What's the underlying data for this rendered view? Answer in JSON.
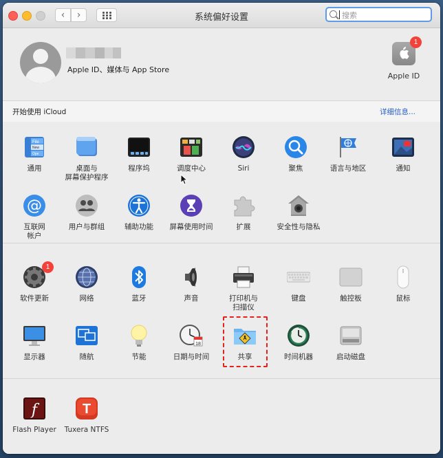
{
  "window": {
    "title": "系统偏好设置",
    "search_placeholder": "搜索"
  },
  "account": {
    "subtitle": "Apple ID、媒体与 App Store",
    "apple_id_label": "Apple ID",
    "apple_id_badge": "1"
  },
  "icloud": {
    "text": "开始使用 iCloud",
    "link": "详细信息..."
  },
  "section1": {
    "items": [
      {
        "label": "通用"
      },
      {
        "label": "桌面与\n屏幕保护程序"
      },
      {
        "label": "程序坞"
      },
      {
        "label": "调度中心"
      },
      {
        "label": "Siri"
      },
      {
        "label": "聚焦"
      },
      {
        "label": "语言与地区"
      },
      {
        "label": "通知"
      },
      {
        "label": "互联网\n帐户"
      },
      {
        "label": "用户与群组"
      },
      {
        "label": "辅助功能"
      },
      {
        "label": "屏幕使用时间"
      },
      {
        "label": "扩展"
      },
      {
        "label": "安全性与隐私"
      }
    ]
  },
  "section2": {
    "items": [
      {
        "label": "软件更新",
        "badge": "1"
      },
      {
        "label": "网络"
      },
      {
        "label": "蓝牙"
      },
      {
        "label": "声音"
      },
      {
        "label": "打印机与\n扫描仪"
      },
      {
        "label": "键盘"
      },
      {
        "label": "触控板"
      },
      {
        "label": "鼠标"
      },
      {
        "label": "显示器"
      },
      {
        "label": "随航"
      },
      {
        "label": "节能"
      },
      {
        "label": "日期与时间",
        "calendar_day": "18"
      },
      {
        "label": "共享"
      },
      {
        "label": "时间机器"
      },
      {
        "label": "启动磁盘"
      }
    ]
  },
  "section3": {
    "items": [
      {
        "label": "Flash Player"
      },
      {
        "label": "Tuxera NTFS"
      }
    ]
  },
  "colors": {
    "accent": "#5f9ae6",
    "highlight_border": "#e3221b",
    "badge": "#f3423a"
  }
}
